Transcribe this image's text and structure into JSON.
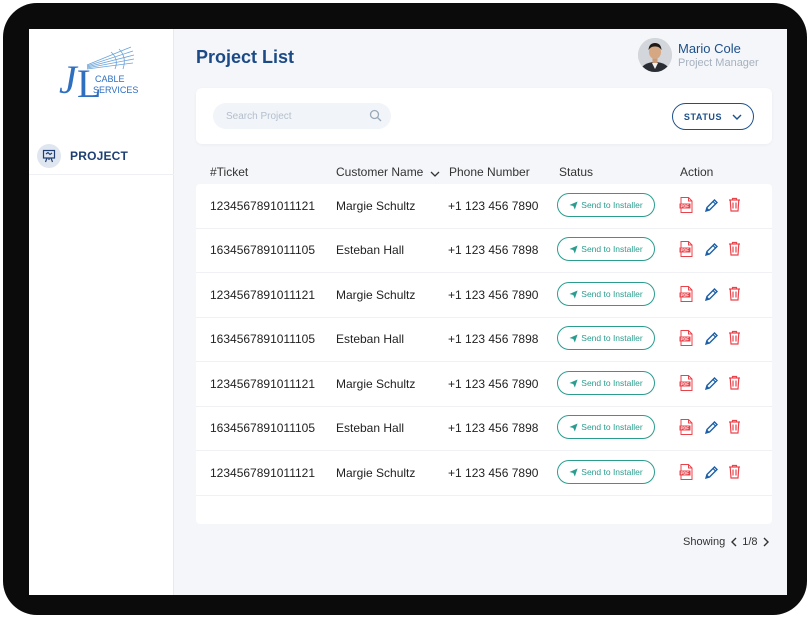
{
  "brand": {
    "logo_letters": "JL",
    "logo_line1": "CABLE",
    "logo_line2": "SERVICES"
  },
  "sidebar": {
    "items": [
      {
        "label": "PROJECT",
        "icon": "presentation-board-icon"
      }
    ]
  },
  "header": {
    "title": "Project List",
    "user": {
      "name": "Mario Cole",
      "role": "Project Manager"
    }
  },
  "filters": {
    "search_placeholder": "Search Project",
    "status_label": "STATUS"
  },
  "table": {
    "columns": [
      "#Ticket",
      "Customer Name",
      "Phone Number",
      "Status",
      "Action"
    ],
    "rows": [
      {
        "ticket": "1234567891011121",
        "customer": "Margie Schultz",
        "phone": "+1 123 456 7890",
        "status": "Send to Installer"
      },
      {
        "ticket": "1634567891011105",
        "customer": "Esteban Hall",
        "phone": "+1 123 456 7898",
        "status": "Send to Installer"
      },
      {
        "ticket": "1234567891011121",
        "customer": "Margie Schultz",
        "phone": "+1 123 456 7890",
        "status": "Send to Installer"
      },
      {
        "ticket": "1634567891011105",
        "customer": "Esteban Hall",
        "phone": "+1 123 456 7898",
        "status": "Send to Installer"
      },
      {
        "ticket": "1234567891011121",
        "customer": "Margie Schultz",
        "phone": "+1 123 456 7890",
        "status": "Send to Installer"
      },
      {
        "ticket": "1634567891011105",
        "customer": "Esteban Hall",
        "phone": "+1 123 456 7898",
        "status": "Send to Installer"
      },
      {
        "ticket": "1234567891011121",
        "customer": "Margie Schultz",
        "phone": "+1 123 456 7890",
        "status": "Send to Installer"
      }
    ]
  },
  "pagination": {
    "label": "Showing",
    "page": "1/8"
  },
  "colors": {
    "brand_blue": "#1c4a86",
    "status_teal": "#2a9d8f",
    "danger_red": "#e8434b",
    "edit_blue": "#1d5fa8"
  }
}
